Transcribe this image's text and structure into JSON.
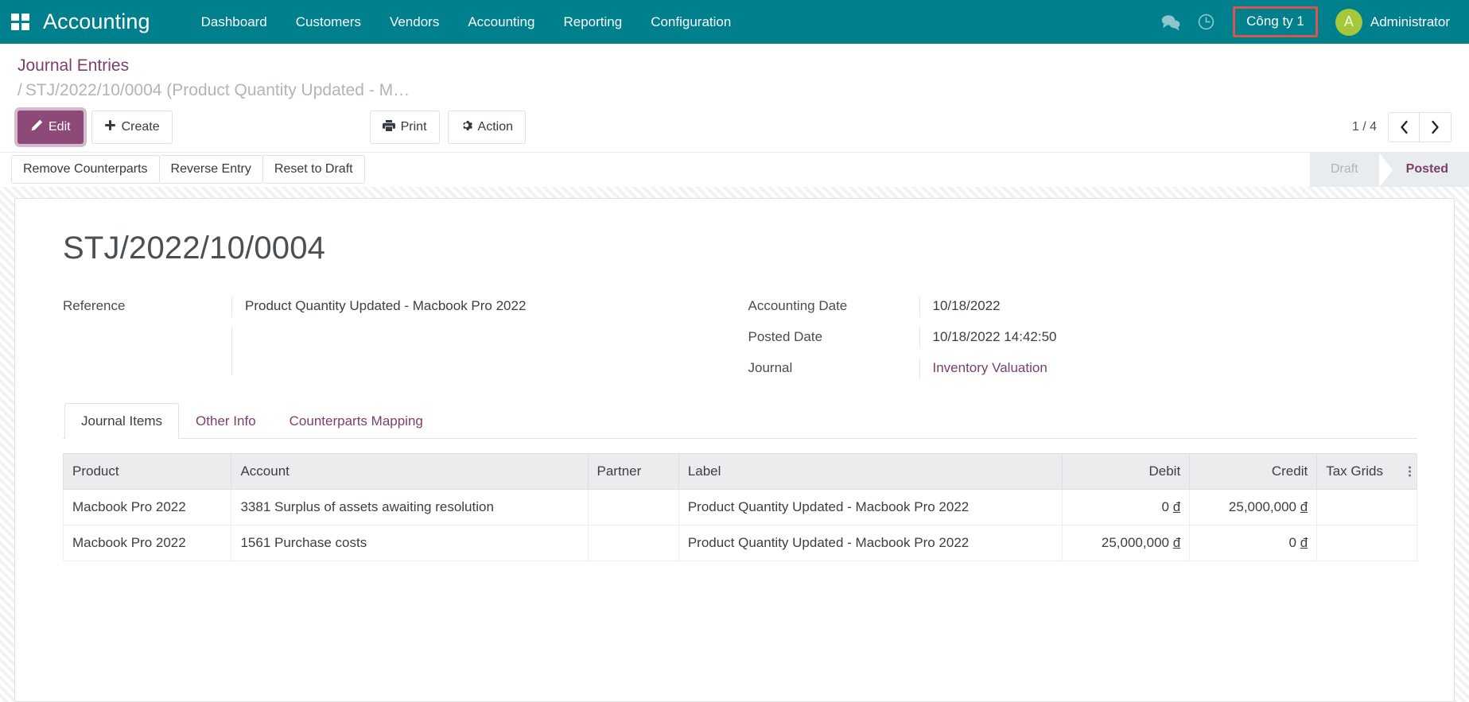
{
  "navbar": {
    "apps_icon": "apps-grid-icon",
    "brand": "Accounting",
    "menu": [
      {
        "label": "Dashboard"
      },
      {
        "label": "Customers"
      },
      {
        "label": "Vendors"
      },
      {
        "label": "Accounting"
      },
      {
        "label": "Reporting"
      },
      {
        "label": "Configuration"
      }
    ],
    "messages_icon": "messages-icon",
    "activities_icon": "clock-icon",
    "company": "Công ty 1",
    "company_highlight_color": "#d9534f",
    "avatar_initial": "A",
    "user_name": "Administrator",
    "background_color": "#00808c"
  },
  "breadcrumb": {
    "root": "Journal Entries",
    "separator": "/",
    "current": "STJ/2022/10/0004 (Product Quantity Updated - M…"
  },
  "controls": {
    "edit_label": "Edit",
    "create_label": "Create",
    "print_label": "Print",
    "action_label": "Action",
    "pager": "1 / 4",
    "prev_icon": "chevron-left-icon",
    "next_icon": "chevron-right-icon",
    "primary_color": "#8d4a78"
  },
  "statusbar": {
    "actions": [
      {
        "label": "Remove Counterparts"
      },
      {
        "label": "Reverse Entry"
      },
      {
        "label": "Reset to Draft"
      }
    ],
    "stages": [
      {
        "label": "Draft",
        "active": false
      },
      {
        "label": "Posted",
        "active": true
      }
    ],
    "active_color": "#7c3f69"
  },
  "record": {
    "title": "STJ/2022/10/0004",
    "left_fields": [
      {
        "label": "Reference",
        "value": "Product Quantity Updated - Macbook Pro 2022",
        "link": false
      }
    ],
    "right_fields": [
      {
        "label": "Accounting Date",
        "value": "10/18/2022",
        "link": false
      },
      {
        "label": "Posted Date",
        "value": "10/18/2022 14:42:50",
        "link": false
      },
      {
        "label": "Journal",
        "value": "Inventory Valuation",
        "link": true
      }
    ]
  },
  "notebook": {
    "tabs": [
      {
        "label": "Journal Items",
        "active": true
      },
      {
        "label": "Other Info",
        "active": false
      },
      {
        "label": "Counterparts Mapping",
        "active": false
      }
    ]
  },
  "table": {
    "columns": [
      {
        "label": "Product",
        "align": "left"
      },
      {
        "label": "Account",
        "align": "left"
      },
      {
        "label": "Partner",
        "align": "left"
      },
      {
        "label": "Label",
        "align": "left"
      },
      {
        "label": "Debit",
        "align": "right"
      },
      {
        "label": "Credit",
        "align": "right"
      },
      {
        "label": "Tax Grids",
        "align": "left"
      }
    ],
    "optional_columns_icon": "column-options-icon",
    "rows": [
      {
        "product": "Macbook Pro 2022",
        "account": "3381 Surplus of assets awaiting resolution",
        "partner": "",
        "label": "Product Quantity Updated - Macbook Pro 2022",
        "debit": "0",
        "debit_currency": "đ",
        "credit": "25,000,000",
        "credit_currency": "đ",
        "tax_grids": ""
      },
      {
        "product": "Macbook Pro 2022",
        "account": "1561 Purchase costs",
        "partner": "",
        "label": "Product Quantity Updated - Macbook Pro 2022",
        "debit": "25,000,000",
        "debit_currency": "đ",
        "credit": "0",
        "credit_currency": "đ",
        "tax_grids": ""
      }
    ]
  }
}
